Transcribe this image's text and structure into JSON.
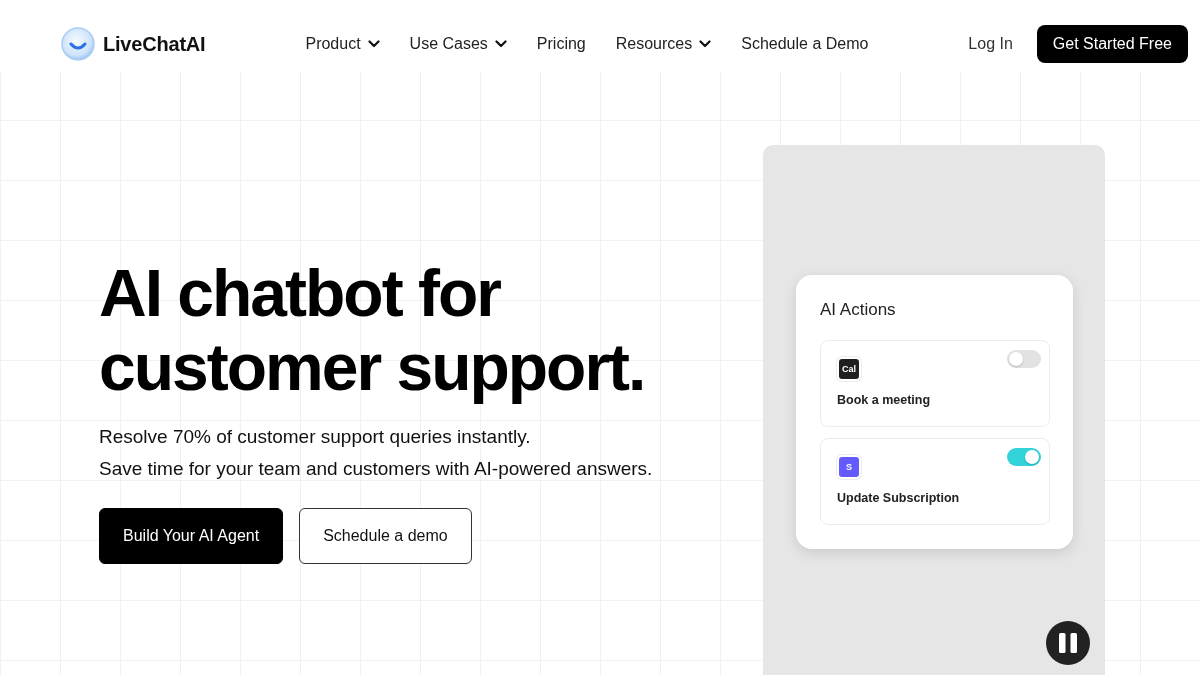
{
  "header": {
    "brand": "LiveChatAI",
    "nav": [
      {
        "label": "Product",
        "has_menu": true
      },
      {
        "label": "Use Cases",
        "has_menu": true
      },
      {
        "label": "Pricing",
        "has_menu": false
      },
      {
        "label": "Resources",
        "has_menu": true
      },
      {
        "label": "Schedule a Demo",
        "has_menu": false
      }
    ],
    "login": "Log In",
    "cta": "Get Started Free"
  },
  "hero": {
    "headline": "AI chatbot for customer support.",
    "subtitle_lines": [
      "Resolve 70% of customer support queries instantly.",
      "Save time for your team and customers with AI-powered answers."
    ],
    "buttons": [
      {
        "label": "Build Your AI Agent",
        "kind": "primary"
      },
      {
        "label": "Schedule a demo",
        "kind": "secondary"
      }
    ]
  },
  "demo": {
    "playing": true,
    "card_title": "AI Actions",
    "actions": [
      {
        "app_logo": "Cal",
        "color": "#1f1f1f",
        "label": "Book a meeting",
        "on": false
      },
      {
        "app_logo": "S",
        "color": "#635bff",
        "label": "Update Subscription",
        "on": true
      }
    ]
  }
}
